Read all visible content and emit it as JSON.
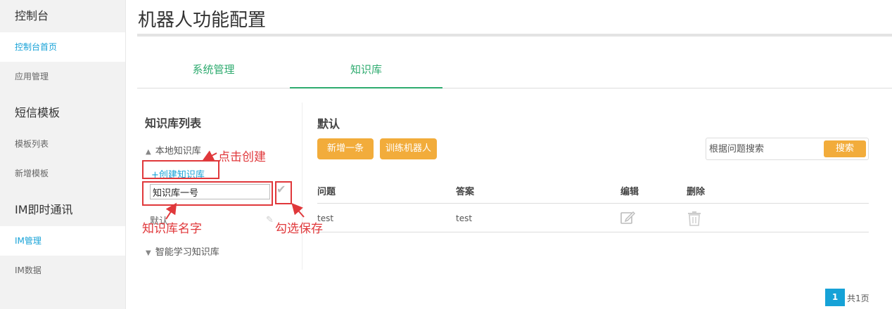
{
  "sidebar": {
    "sections": [
      {
        "title": "控制台",
        "items": [
          "控制台首页",
          "应用管理"
        ]
      },
      {
        "title": "短信模板",
        "items": [
          "模板列表",
          "新增模板"
        ]
      },
      {
        "title": "IM即时通讯",
        "items": [
          "IM管理",
          "IM数据"
        ]
      }
    ],
    "active_items": [
      "控制台首页",
      "IM管理"
    ]
  },
  "page": {
    "title": "机器人功能配置"
  },
  "tabs": [
    {
      "label": "系统管理",
      "active": false
    },
    {
      "label": "知识库",
      "active": true
    }
  ],
  "kb_list": {
    "title": "知识库列表",
    "local_group": "本地知识库",
    "create_link": "+创建知识库",
    "name_input_value": "知识库一号",
    "default_item": "默认",
    "smart_group": "智能学习知识库"
  },
  "main": {
    "title": "默认",
    "add_button": "新增一条",
    "train_button": "训练机器人",
    "search_placeholder": "根据问题搜索",
    "search_button": "搜索",
    "columns": [
      "问题",
      "答案",
      "编辑",
      "删除"
    ],
    "rows": [
      {
        "question": "test",
        "answer": "test"
      }
    ]
  },
  "pagination": {
    "current": "1",
    "total": "共1页"
  },
  "annotations": {
    "create": "点击创建",
    "name": "知识库名字",
    "save": "勾选保存",
    "color": "#e0383b"
  },
  "colors": {
    "accent_green": "#2eab6f",
    "link_blue": "#16a2d7",
    "button_orange": "#f2ac3b"
  },
  "icons": [
    "triangle-up-icon",
    "triangle-down-icon",
    "checkmark-icon",
    "edit-icon",
    "trash-icon"
  ]
}
